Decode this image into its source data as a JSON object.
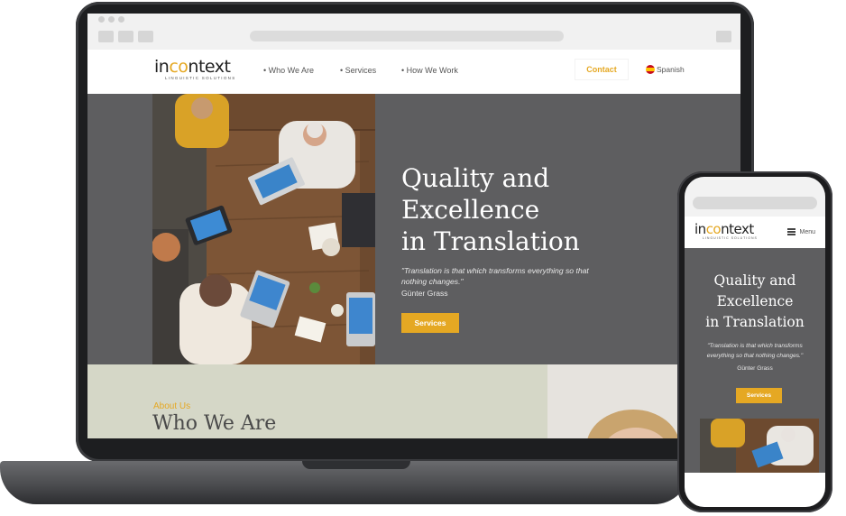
{
  "site": {
    "logo_prefix": "in",
    "logo_accent": "co",
    "logo_suffix": "ntext",
    "logo_tagline": "LINGUISTIC SOLUTIONS",
    "accent_color": "#e5a823"
  },
  "nav": {
    "items": [
      {
        "label": "• Who We Are"
      },
      {
        "label": "• Services"
      },
      {
        "label": "• How We Work"
      }
    ],
    "contact_label": "Contact",
    "language_label": "Spanish",
    "language_icon": "spain-flag-icon"
  },
  "hero": {
    "title": "Quality and\nExcellence\nin Translation",
    "quote": "\"Translation is that which transforms everything so that nothing changes.\"",
    "author": "Günter Grass",
    "button_label": "Services"
  },
  "about": {
    "label": "About Us",
    "title": "Who We Are"
  },
  "mobile": {
    "menu_label": "Menu",
    "menu_icon": "hamburger-icon",
    "title": "Quality and\nExcellence\nin Translation",
    "quote": "\"Translation is that which transforms everything so that nothing changes.\"",
    "author": "Günter Grass",
    "button_label": "Services"
  }
}
